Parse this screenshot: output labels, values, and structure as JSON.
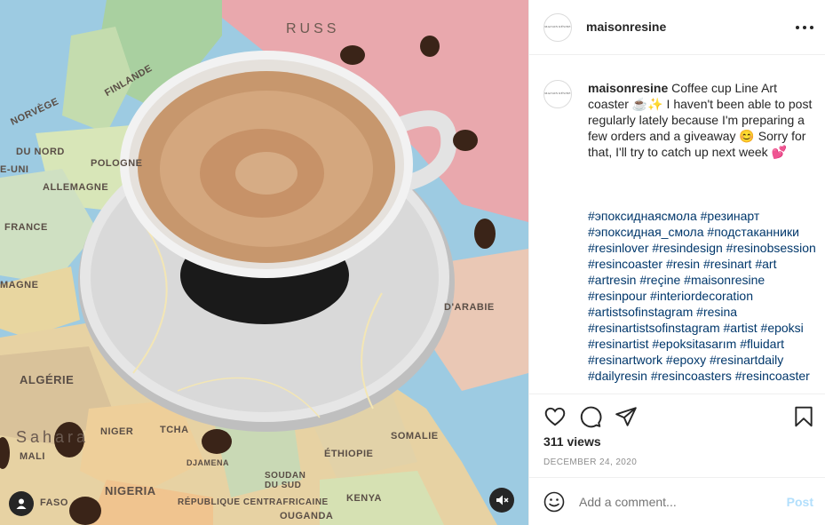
{
  "post": {
    "username": "maisonresine",
    "avatar_text": "MAISON RÉSINE",
    "more_icon": "more-horizontal-icon",
    "caption_user": "maisonresine",
    "caption_text": "Coffee cup Line Art coaster ☕️✨ I haven't been able to post regularly lately because I'm preparing a few orders and a giveaway 😊 Sorry for that, I'll try to catch up next week 💕",
    "hashtags": [
      "#эпоксиднаясмола",
      "#резинарт",
      "#эпоксидная_смола",
      "#подстаканники",
      "#resinlover",
      "#resindesign",
      "#resinobsession",
      "#resincoaster",
      "#resin",
      "#resinart",
      "#art",
      "#artresin",
      "#reçine",
      "#maisonresine",
      "#resinpour",
      "#interiordecoration",
      "#artistsofinstagram",
      "#resina",
      "#resinartistsofinstagram",
      "#artist",
      "#epoksi",
      "#resinartist",
      "#epoksitasarım",
      "#fluidart",
      "#resinartwork",
      "#epoxy",
      "#resinartdaily",
      "#dailyresin",
      "#resincoasters",
      "#resincoaster"
    ],
    "views": "311 views",
    "date": "DECEMBER 24, 2020",
    "comment_placeholder": "Add a comment...",
    "post_button": "Post"
  },
  "media": {
    "map_labels": [
      "RUSS",
      "NORVÈGE",
      "FINLANDE",
      "POLOGNE",
      "ALLEMAGNE",
      "FRANCE",
      "MAGNE",
      "ALGÉRIE",
      "NIGER",
      "TCHA",
      "MALI",
      "NIGERIA",
      "ÉTHIOPIE",
      "SOMALIE",
      "D'ARABIE",
      "RÉPUBLIQUE CENTRAFRICAINE",
      "SOUDAN DU SUD",
      "OUGANDA",
      "KENYA",
      "Sahara",
      "DJAMENA",
      "FASO",
      "E-UNI",
      "DU NORD"
    ],
    "tag_icon": "user-tag-icon",
    "mute_icon": "speaker-muted-icon"
  },
  "icons": {
    "like": "heart-icon",
    "comment": "comment-icon",
    "share": "paper-plane-icon",
    "save": "bookmark-icon",
    "emoji": "smiley-icon"
  },
  "colors": {
    "link": "#00376b",
    "post_disabled": "#b2dffc",
    "muted_text": "#8e8e8e"
  }
}
